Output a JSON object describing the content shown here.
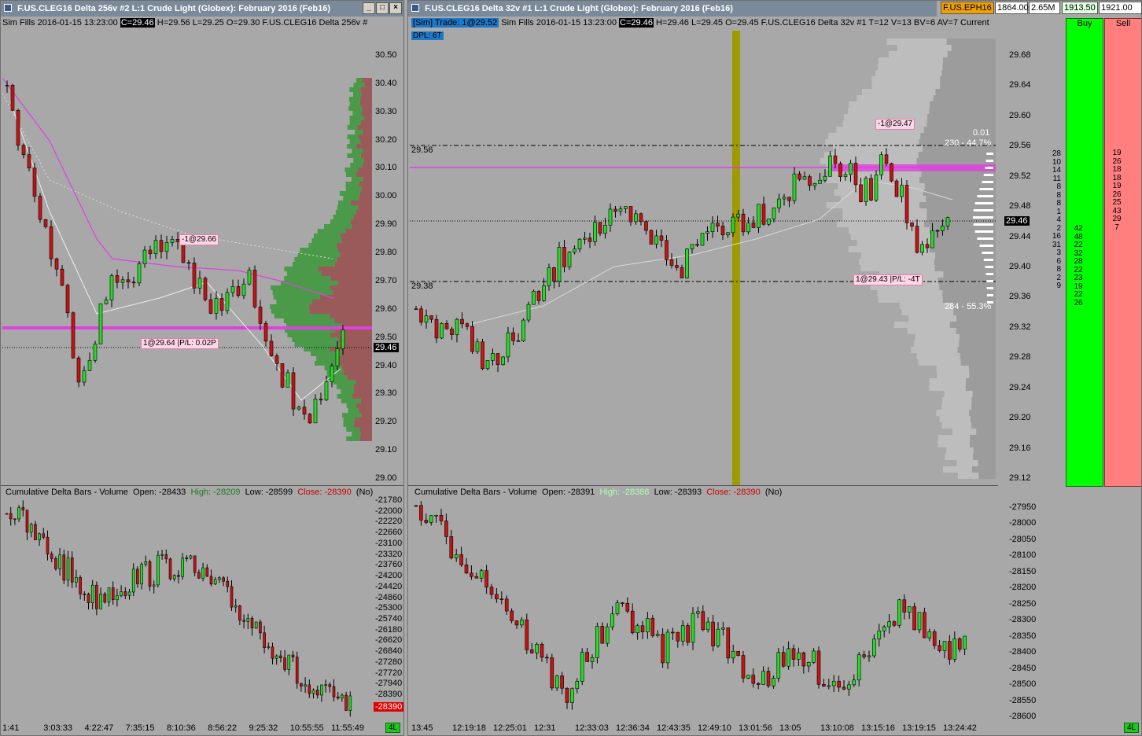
{
  "left": {
    "title": "F.US.CLEG16  Delta 256v  #2  L:1  Crude Light (Globex): February 2016 (Feb16)",
    "info": {
      "prefix": "Sim Fills  2016-01-15 13:23:00",
      "close": "C=29.46",
      "rest": "H=29.56 L=29.25 O=29.30 F.US.CLEG16  Delta 256v  #"
    },
    "price_axis": [
      "30.50",
      "30.40",
      "30.30",
      "30.20",
      "30.10",
      "30.00",
      "29.90",
      "29.80",
      "29.70",
      "29.60",
      "29.50",
      "29.40",
      "29.30",
      "29.20",
      "29.10",
      "29.00"
    ],
    "current_price": "29.46",
    "labels": {
      "sell": "-1@29.66",
      "buy": "1@29.64 |P/L: 0.02P"
    },
    "delta": {
      "title": "Cumulative Delta Bars - Volume",
      "open": "Open: -28433",
      "high": "High: -28209",
      "low": "Low: -28599",
      "close": "Close: -28390",
      "flag": "(No)",
      "axis": [
        "-21780",
        "-22000",
        "-22220",
        "-22660",
        "-23100",
        "-23320",
        "-23760",
        "-24200",
        "-24420",
        "-24860",
        "-25300",
        "-25740",
        "-26180",
        "-26620",
        "-26840",
        "-27280",
        "-27720",
        "-27940",
        "-28390"
      ],
      "current": "-28390"
    },
    "time_axis": [
      "1:41",
      "3:03:33",
      "4:22:47",
      "7:35:15",
      "8:10:36",
      "8:56:22",
      "9:25:32",
      "10:55:55",
      "11:55:49"
    ],
    "status": "4L"
  },
  "right": {
    "title": "F.US.CLEG16  Delta 32v  #1  L:1  Crude Light (Globex): February 2016 (Feb16)",
    "info": {
      "sim": "[Sim]  Trade: 1@29.52",
      "prefix": " Sim Fills  2016-01-15 13:23:00",
      "close": "C=29.46",
      "rest": "H=29.46 L=29.45 O=29.45 F.US.CLEG16  Delta 32v  #1 T=12 V=13 BV=6 AV=7  Current",
      "dpl": "DPL: 6T"
    },
    "price_axis": [
      "29.68",
      "29.64",
      "29.60",
      "29.56",
      "29.52",
      "29.48",
      "29.44",
      "29.40",
      "29.36",
      "29.32",
      "29.28",
      "29.24",
      "29.20",
      "29.16",
      "29.12"
    ],
    "current_price": "29.46",
    "level_hi": "29.56",
    "level_lo": "29.38",
    "labels": {
      "sell": "-1@29.47",
      "buy": "1@29.43 |P/L: -4T",
      "pct_top": "230 - 44.7%",
      "pct_bot": "284 - 55.3%",
      "tick": "0.01"
    },
    "dom": {
      "buy_header": "Buy",
      "sell_header": "Sell",
      "col1": [
        "28",
        "10",
        "14",
        "11",
        "8",
        "8",
        "8",
        "1",
        "4",
        "2",
        "16",
        "31",
        "3",
        "6",
        "8",
        "2",
        "9"
      ],
      "col2": [
        "81",
        "3",
        "5",
        "2",
        "8",
        "7",
        "28",
        "15",
        "17",
        "34",
        "4",
        "2",
        "6",
        "4",
        "16",
        "6"
      ],
      "buy_vals": [
        "42",
        "48",
        "22",
        "32",
        "28",
        "22",
        "23",
        "19",
        "22",
        "26"
      ],
      "sell_vals": [
        "19",
        "26",
        "18",
        "18",
        "19",
        "26",
        "25",
        "43",
        "29",
        "7"
      ]
    },
    "delta": {
      "title": "Cumulative Delta Bars - Volume",
      "open": "Open: -28391",
      "high": "High: -28386",
      "low": "Low: -28393",
      "close": "Close: -28390",
      "flag": "(No)",
      "axis": [
        "-27950",
        "-28000",
        "-28050",
        "-28100",
        "-28150",
        "-28200",
        "-28250",
        "-28300",
        "-28350",
        "-28400",
        "-28450",
        "-28500",
        "-28550",
        "-28600"
      ]
    },
    "time_axis": [
      "13:45",
      "12:19:18",
      "12:25:01",
      "12:31",
      "12:33:03",
      "12:36:34",
      "12:43:35",
      "12:49:10",
      "13:01:56",
      "13:05",
      "13:10:08",
      "13:15:16",
      "13:19:15",
      "13:24:42"
    ],
    "status": "4L"
  },
  "ticker": {
    "symbol": "F.US.EPH16",
    "last": "1864.00",
    "volume": "2.65M",
    "bid": "1913.50",
    "ask": "1921.00"
  },
  "colors": {
    "up": "#22dd22",
    "down": "#cc1111",
    "profile_green": "#4a9a4a",
    "profile_red": "#9a5a5a",
    "magenta": "#e040e0",
    "olive": "#a09a00"
  }
}
